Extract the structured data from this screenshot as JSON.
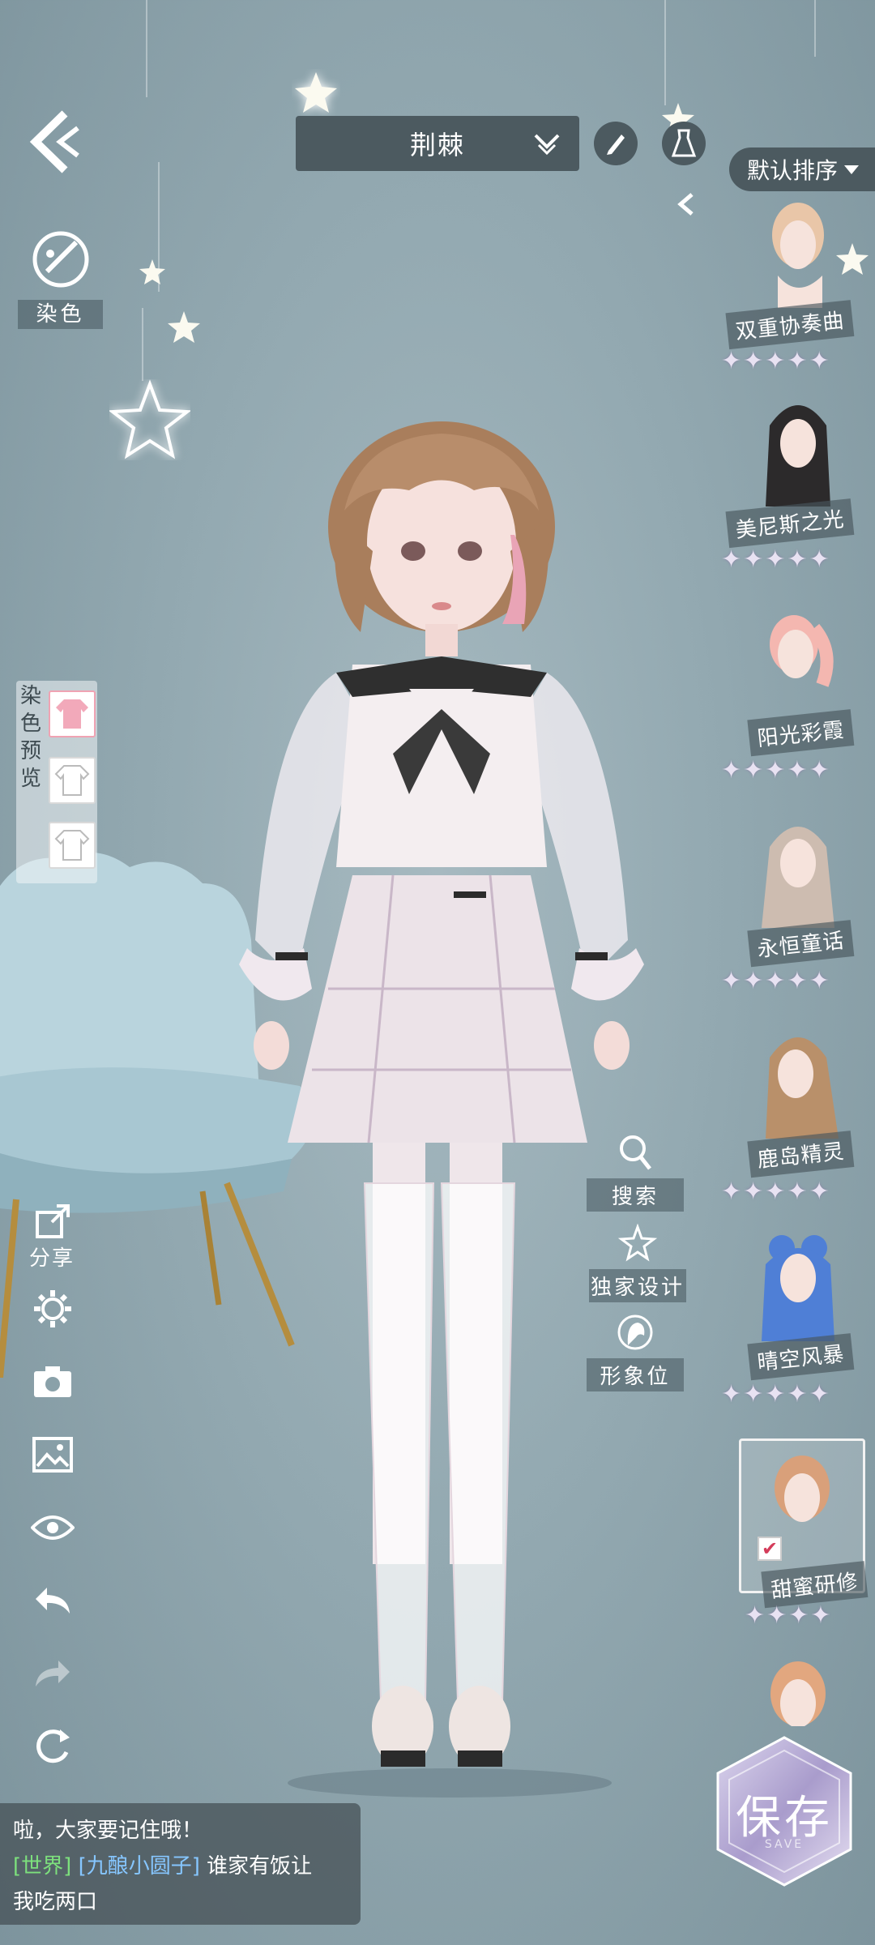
{
  "header": {
    "title": "荆棘",
    "sort_label": "默认排序"
  },
  "dye": {
    "label": "染色"
  },
  "dye_preview": {
    "label_chars": [
      "染",
      "色",
      "预",
      "览"
    ]
  },
  "hair_list": [
    {
      "name": "双重协奏曲",
      "stars": 5,
      "hair_color": "#e9c6a8"
    },
    {
      "name": "美尼斯之光",
      "stars": 5,
      "hair_color": "#2c2a2b"
    },
    {
      "name": "阳光彩霞",
      "stars": 5,
      "hair_color": "#f4b7b0"
    },
    {
      "name": "永恒童话",
      "stars": 5,
      "hair_color": "#cdbcb0"
    },
    {
      "name": "鹿岛精灵",
      "stars": 5,
      "hair_color": "#b9906a"
    },
    {
      "name": "晴空风暴",
      "stars": 5,
      "hair_color": "#4f7fd6"
    },
    {
      "name": "甜蜜研修",
      "stars": 4,
      "hair_color": "#d9a07a",
      "selected": true
    },
    {
      "name": "",
      "stars": 0,
      "hair_color": "#e2a77f"
    }
  ],
  "actions": {
    "search": "搜索",
    "exclusive": "独家设计",
    "image_slot": "形象位"
  },
  "tools": {
    "share": "分享"
  },
  "chat": {
    "line1": "啦，大家要记住哦！",
    "channel": "[世界]",
    "user": "[九酿小圆子]",
    "message_a": "谁家有饭让",
    "message_b": "我吃两口"
  },
  "save": {
    "label": "保存",
    "sub": "SAVE"
  },
  "colors": {
    "panel": "#4c5a60",
    "accent": "#d43c5a"
  }
}
